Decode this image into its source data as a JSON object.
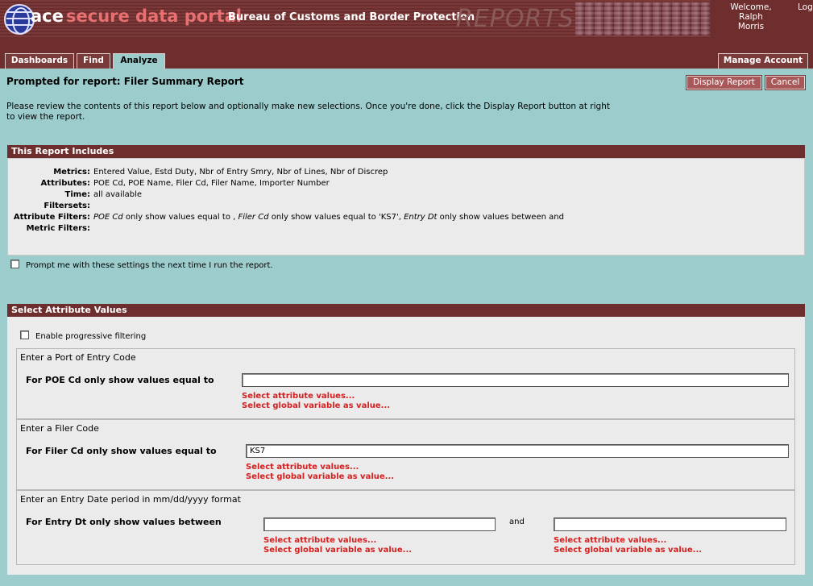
{
  "header": {
    "logo_ace": "ace",
    "logo_portal": "secure data portal",
    "bureau": "Bureau of Customs and Border Protection",
    "reports": "REPORTS",
    "welcome_line1": "Welcome,",
    "welcome_line2": "Ralph",
    "welcome_line3": "Morris",
    "logout": "Log"
  },
  "tabs": [
    {
      "label": "Dashboards"
    },
    {
      "label": "Find"
    },
    {
      "label": "Analyze",
      "active": true
    }
  ],
  "manage_account": "Manage Account",
  "page_title": "Prompted for report: Filer Summary Report",
  "buttons": {
    "display": "Display Report",
    "cancel": "Cancel"
  },
  "intro_line1": "Please review the contents of this report below and optionally make new selections. Once you're done, click the Display Report button at right",
  "intro_line2": "to view the report.",
  "includes": {
    "title": "This Report Includes",
    "metrics_label": "Metrics:",
    "metrics": "Entered Value, Estd Duty, Nbr of Entry Smry, Nbr of Lines, Nbr of Discrep",
    "attributes_label": "Attributes:",
    "attributes": "POE Cd, POE Name, Filer Cd, Filer Name, Importer Number",
    "time_label": "Time:",
    "time": "all available",
    "filtersets_label": "Filtersets:",
    "attr_filters_label": "Attribute Filters:",
    "attr_filter_parts": {
      "a1": "POE Cd",
      "t1": " only show values equal to , ",
      "a2": "Filer Cd",
      "t2": " only show values equal to 'KS7', ",
      "a3": "Entry Dt",
      "t3": " only show values between and"
    },
    "metric_filters_label": "Metric Filters:"
  },
  "prompt_me": "Prompt me with these settings the next time I run the report.",
  "select": {
    "title": "Select Attribute Values",
    "progressive": "Enable progressive filtering",
    "select_attr": "Select attribute values...",
    "select_global": "Select global variable as value...",
    "poe": {
      "title": "Enter a Port of Entry Code",
      "label": "For POE Cd  only show values equal to",
      "value": ""
    },
    "filer": {
      "title": "Enter a Filer Code",
      "label": "For Filer Cd  only show values equal to",
      "value": "KS7"
    },
    "entry": {
      "title": "Enter an Entry Date period in mm/dd/yyyy format",
      "label": "For Entry Dt  only show values between",
      "and": "and",
      "from": "",
      "to": ""
    }
  },
  "colors": {
    "maroon": "#6e2e2e",
    "teal_bg": "#9ccccc",
    "link_red": "#d42020"
  }
}
